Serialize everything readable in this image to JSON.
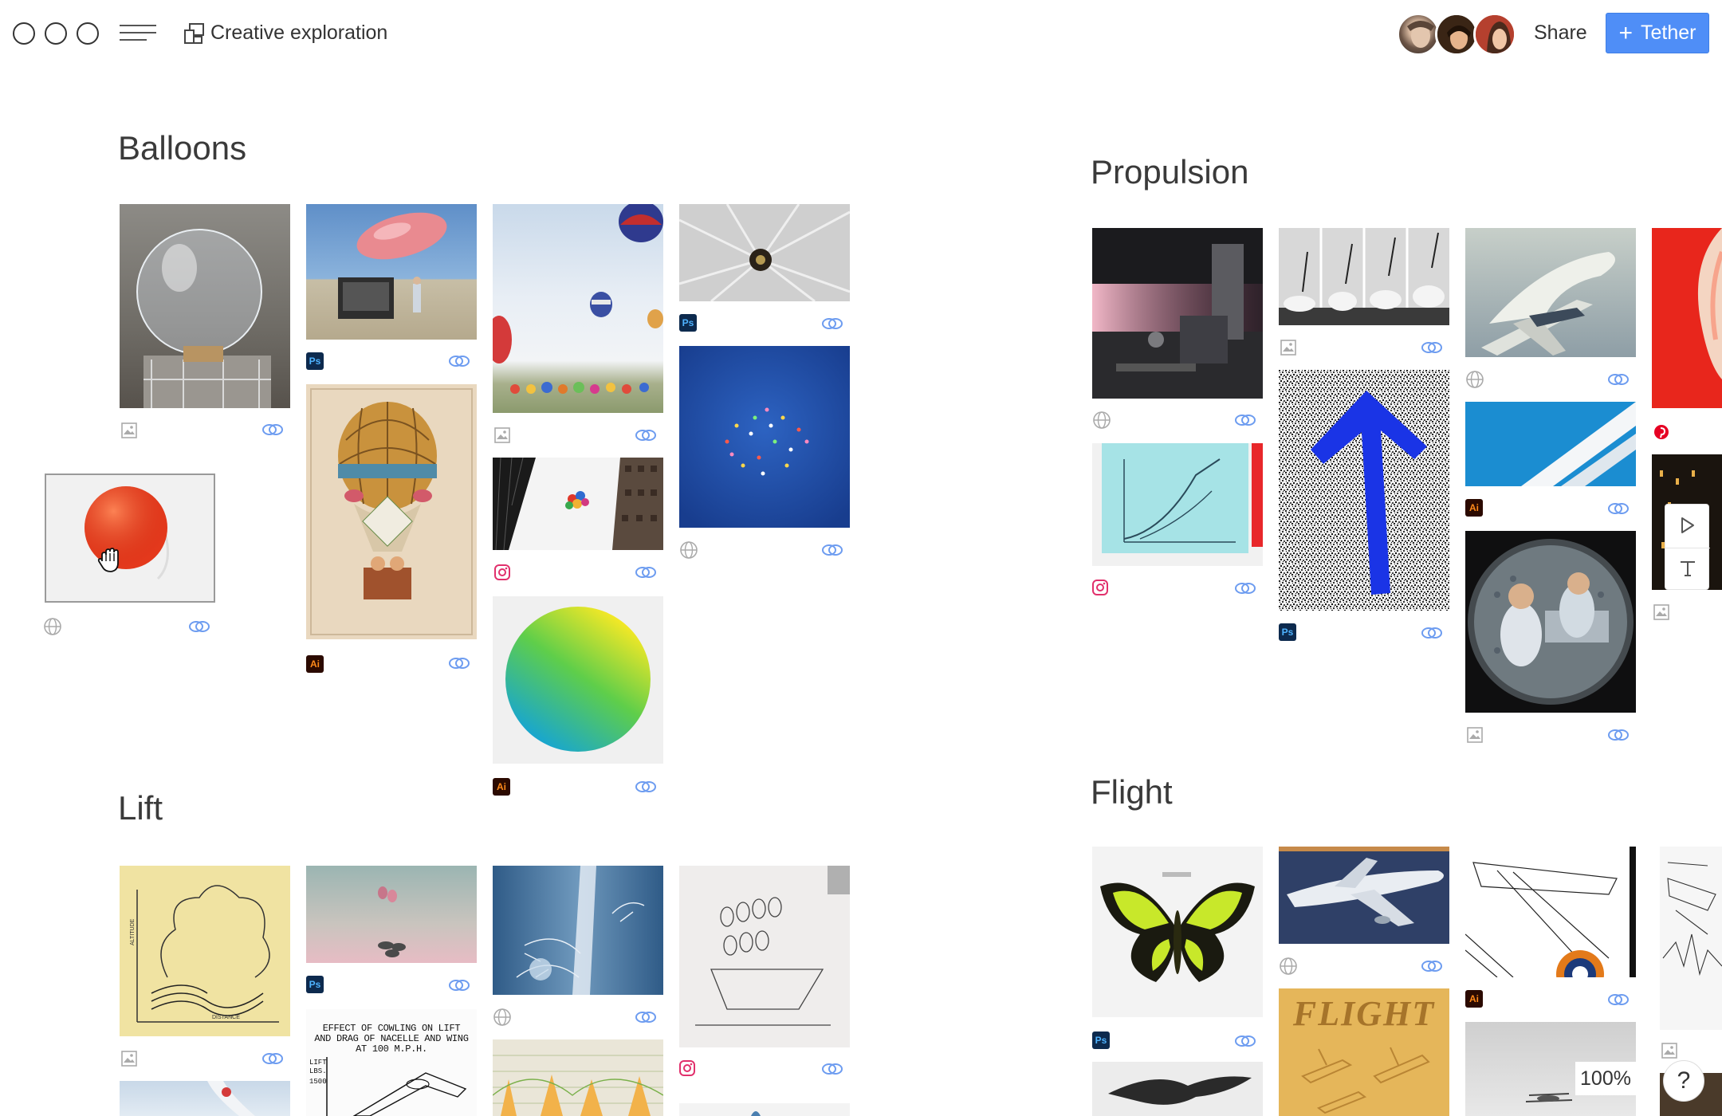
{
  "toolbar": {
    "project_title": "Creative exploration",
    "share_label": "Share",
    "tether_label": "Tether",
    "accent_color": "#4f8ef7"
  },
  "collaborators": [
    "avatar-1",
    "avatar-2",
    "avatar-3"
  ],
  "sections": {
    "balloons": "Balloons",
    "propulsion": "Propulsion",
    "lift": "Lift",
    "flight": "Flight"
  },
  "lift_chart_text": {
    "title": "EFFECT OF COWLING ON LIFT AND DRAG OF NACELLE AND WING AT 100 M.P.H.",
    "y_label": "LIFT LBS.",
    "y_value": "1500",
    "x_label": "DISTANCE",
    "side_label": "ALTITUDE"
  },
  "flight_poster_title": "FLIGHT",
  "zoom": "100%",
  "help": "?"
}
